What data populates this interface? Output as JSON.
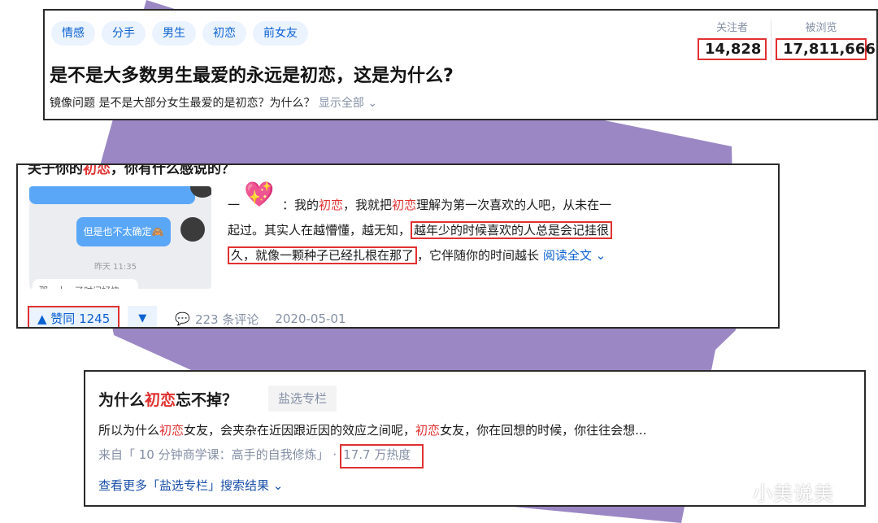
{
  "colors": {
    "accent_blue": "#0b62d1",
    "highlight_red": "#e03131",
    "background_purple": "#9b87c4",
    "muted_gray": "#8590a6"
  },
  "question": {
    "tags": [
      "情感",
      "分手",
      "男生",
      "初恋",
      "前女友"
    ],
    "title": "是不是大多数男生最爱的永远是初恋，这是为什么?",
    "mirror_prefix": "镜像问题 是不是大部分女生最爱的是初恋？为什么？",
    "show_all": "显示全部 ⌄",
    "followers_label": "关注者",
    "followers_value": "14,828",
    "views_label": "被浏览",
    "views_value": "17,811,666"
  },
  "answer": {
    "title_a": "关于你的",
    "title_hl": "初恋",
    "title_b": "，你有什么感说的？",
    "thumb_bubble": "但是也不太确定🙈",
    "thumb_time": "昨天 11:35",
    "thumb_bottom": "那一十一了时间好快",
    "text_1": "一",
    "text_2": "：我的",
    "hl": "初恋",
    "text_3": "，我就把",
    "text_4": "理解为第一次喜欢的人吧，从未在一",
    "text_5": "起过。其实人在越懵懂，越无知，",
    "boxed_1": "越年少的时候喜欢的人总是会记挂很",
    "boxed_2": "久，就像一颗种子已经扎根在那了",
    "text_6": "，它伴随你的时间越长",
    "read_more": "阅读全文 ⌄",
    "vote_up": "▲ 赞同 1245",
    "vote_down": "▼",
    "comment_icon": "comment-icon",
    "comments": "223 条评论",
    "date": "2020-05-01"
  },
  "article": {
    "title_a": "为什么",
    "title_hl": "初恋",
    "title_b": "忘不掉？",
    "badge": "盐选专栏",
    "excerpt_a": "所以为什么",
    "excerpt_hl1": "初恋",
    "excerpt_b": "女友，会夹杂在近因跟近因的效应之间呢，",
    "excerpt_hl2": "初恋",
    "excerpt_c": "女友，你在回想的时候，你往往会想...",
    "source": "来自「 10 分钟商学课：高手的自我修炼」 ·",
    "heat": "17.7 万热度",
    "more": "查看更多「盐选专栏」搜索结果 ⌄"
  },
  "watermark": "小美说美"
}
